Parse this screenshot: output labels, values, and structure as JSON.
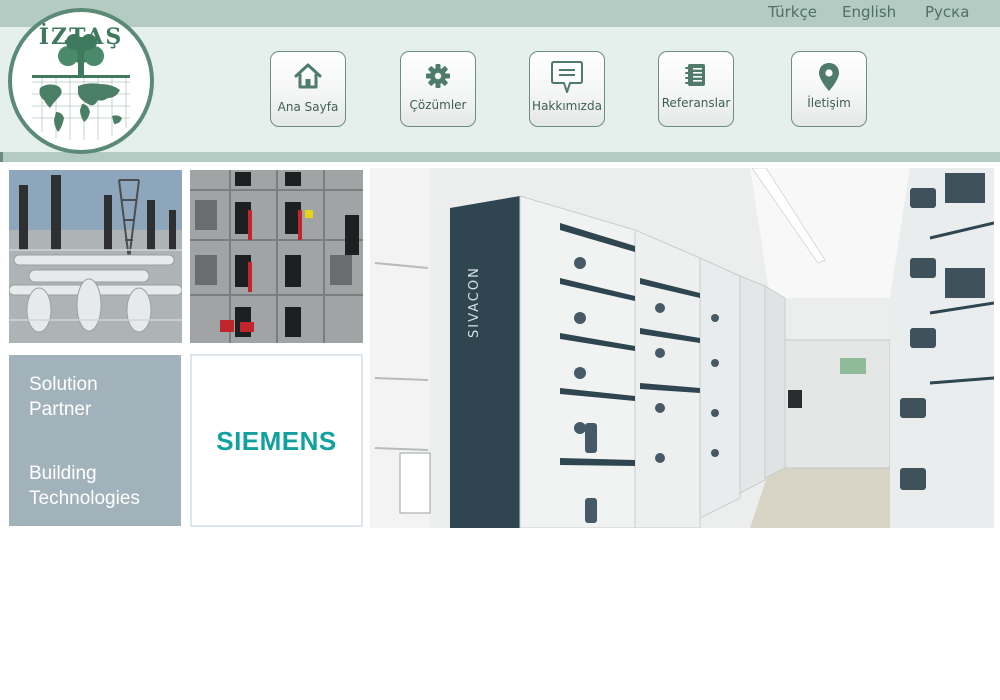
{
  "languages": [
    "Türkçe",
    "English",
    "Руска"
  ],
  "logo": {
    "name": "İZTAŞ",
    "arc_text": "İNŞAAT ELEKTRİK TAAHHÜT TURİZM VE GIDA SAN.TİC.LTD.ŞTİ"
  },
  "nav": {
    "home": "Ana Sayfa",
    "solutions": "Çözümler",
    "about": "Hakkımızda",
    "references": "Referanslar",
    "contact": "İletişim"
  },
  "tiles": {
    "partner_line1": "Solution",
    "partner_line2": "Partner",
    "partner_line3": "Building",
    "partner_line4": "Technologies",
    "brand": "SIEMENS"
  },
  "hero": {
    "cabinet_label": "SIVACON"
  },
  "colors": {
    "topbar": "#b4cbc3",
    "header": "#e5efeb",
    "accent": "#4f7c6a",
    "siemens": "#12a1a1"
  }
}
